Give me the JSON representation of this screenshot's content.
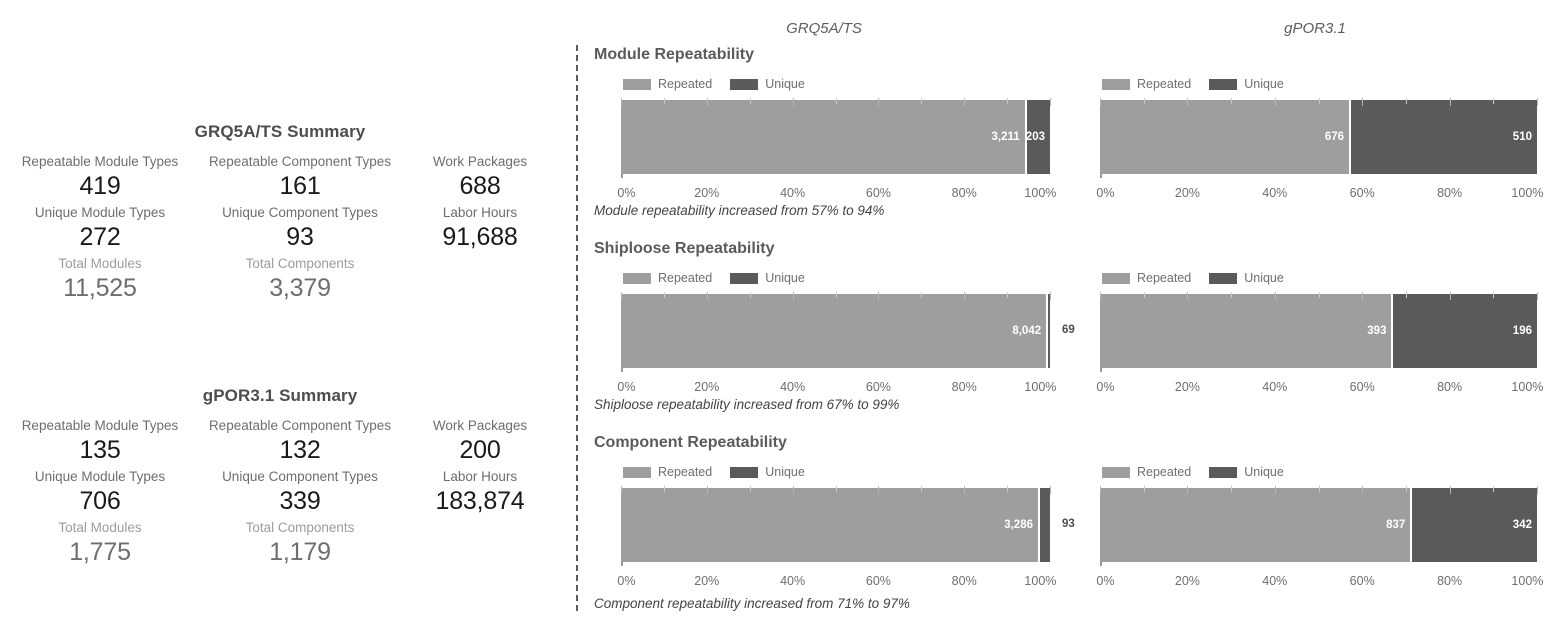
{
  "summaries": [
    {
      "title": "GRQ5A/TS Summary",
      "columns": [
        {
          "items": [
            {
              "label": "Repeatable Module Types",
              "value": "419",
              "muted": false
            },
            {
              "label": "Unique Module Types",
              "value": "272",
              "muted": false
            },
            {
              "label": "Total Modules",
              "value": "11,525",
              "muted": true
            }
          ]
        },
        {
          "items": [
            {
              "label": "Repeatable Component Types",
              "value": "161",
              "muted": false
            },
            {
              "label": "Unique Component Types",
              "value": "93",
              "muted": false
            },
            {
              "label": "Total Components",
              "value": "3,379",
              "muted": true
            }
          ]
        },
        {
          "items": [
            {
              "label": "Work Packages",
              "value": "688",
              "muted": false
            },
            {
              "label": "Labor Hours",
              "value": "91,688",
              "muted": false
            }
          ]
        }
      ]
    },
    {
      "title": "gPOR3.1 Summary",
      "columns": [
        {
          "items": [
            {
              "label": "Repeatable Module Types",
              "value": "135",
              "muted": false
            },
            {
              "label": "Unique Module Types",
              "value": "706",
              "muted": false
            },
            {
              "label": "Total Modules",
              "value": "1,775",
              "muted": true
            }
          ]
        },
        {
          "items": [
            {
              "label": "Repeatable Component Types",
              "value": "132",
              "muted": false
            },
            {
              "label": "Unique Component Types",
              "value": "339",
              "muted": false
            },
            {
              "label": "Total Components",
              "value": "1,179",
              "muted": true
            }
          ]
        },
        {
          "items": [
            {
              "label": "Work Packages",
              "value": "200",
              "muted": false
            },
            {
              "label": "Labor Hours",
              "value": "183,874",
              "muted": false
            }
          ]
        }
      ]
    }
  ],
  "column_headers": {
    "left": "GRQ5A/TS",
    "right": "gPOR3.1"
  },
  "legend": {
    "repeated": "Repeated",
    "unique": "Unique"
  },
  "colors": {
    "repeated": "#9e9e9e",
    "unique": "#5a5a5a",
    "axis_label": "#6e6e6e",
    "title": "#5b5b5b"
  },
  "axis": {
    "tick_labels": [
      "0%",
      "20%",
      "40%",
      "60%",
      "80%",
      "100%"
    ],
    "tick_values": [
      0,
      20,
      40,
      60,
      80,
      100
    ],
    "minor_step": 10
  },
  "rows": [
    {
      "title": "Module Repeatability",
      "note": "Module repeatability increased from 57% to 94%"
    },
    {
      "title": "Shiploose Repeatability",
      "note": "Shiploose repeatability increased from 67% to 99%"
    },
    {
      "title": "Component Repeatability",
      "note": "Component repeatability increased from 71% to 97%"
    }
  ],
  "chart_data": [
    {
      "type": "bar",
      "title": "Module Repeatability",
      "subtitle": "GRQ5A/TS",
      "orientation": "horizontal",
      "stacked": "percent",
      "categories": [
        "GRQ5A/TS"
      ],
      "series": [
        {
          "name": "Repeated",
          "values": [
            3211
          ],
          "label": "3,211",
          "percent": 94.1
        },
        {
          "name": "Unique",
          "values": [
            203
          ],
          "label": "203",
          "percent": 5.9
        }
      ],
      "xlabel": "",
      "ylabel": "",
      "xlim": [
        0,
        100
      ],
      "tick_labels": [
        "0%",
        "20%",
        "40%",
        "60%",
        "80%",
        "100%"
      ],
      "legend_position": "top-left",
      "grid": false
    },
    {
      "type": "bar",
      "title": "Module Repeatability",
      "subtitle": "gPOR3.1",
      "orientation": "horizontal",
      "stacked": "percent",
      "categories": [
        "gPOR3.1"
      ],
      "series": [
        {
          "name": "Repeated",
          "values": [
            676
          ],
          "label": "676",
          "percent": 57.0
        },
        {
          "name": "Unique",
          "values": [
            510
          ],
          "label": "510",
          "percent": 43.0
        }
      ],
      "xlabel": "",
      "ylabel": "",
      "xlim": [
        0,
        100
      ],
      "tick_labels": [
        "0%",
        "20%",
        "40%",
        "60%",
        "80%",
        "100%"
      ],
      "legend_position": "top-left",
      "grid": false
    },
    {
      "type": "bar",
      "title": "Shiploose Repeatability",
      "subtitle": "GRQ5A/TS",
      "orientation": "horizontal",
      "stacked": "percent",
      "categories": [
        "GRQ5A/TS"
      ],
      "series": [
        {
          "name": "Repeated",
          "values": [
            8042
          ],
          "label": "8,042",
          "percent": 99.1
        },
        {
          "name": "Unique",
          "values": [
            69
          ],
          "label": "69",
          "percent": 0.9
        }
      ],
      "xlabel": "",
      "ylabel": "",
      "xlim": [
        0,
        100
      ],
      "tick_labels": [
        "0%",
        "20%",
        "40%",
        "60%",
        "80%",
        "100%"
      ],
      "legend_position": "top-left",
      "grid": false
    },
    {
      "type": "bar",
      "title": "Shiploose Repeatability",
      "subtitle": "gPOR3.1",
      "orientation": "horizontal",
      "stacked": "percent",
      "categories": [
        "gPOR3.1"
      ],
      "series": [
        {
          "name": "Repeated",
          "values": [
            393
          ],
          "label": "393",
          "percent": 66.7
        },
        {
          "name": "Unique",
          "values": [
            196
          ],
          "label": "196",
          "percent": 33.3
        }
      ],
      "xlabel": "",
      "ylabel": "",
      "xlim": [
        0,
        100
      ],
      "tick_labels": [
        "0%",
        "20%",
        "40%",
        "60%",
        "80%",
        "100%"
      ],
      "legend_position": "top-left",
      "grid": false
    },
    {
      "type": "bar",
      "title": "Component Repeatability",
      "subtitle": "GRQ5A/TS",
      "orientation": "horizontal",
      "stacked": "percent",
      "categories": [
        "GRQ5A/TS"
      ],
      "series": [
        {
          "name": "Repeated",
          "values": [
            3286
          ],
          "label": "3,286",
          "percent": 97.2
        },
        {
          "name": "Unique",
          "values": [
            93
          ],
          "label": "93",
          "percent": 2.8
        }
      ],
      "xlabel": "",
      "ylabel": "",
      "xlim": [
        0,
        100
      ],
      "tick_labels": [
        "0%",
        "20%",
        "40%",
        "60%",
        "80%",
        "100%"
      ],
      "legend_position": "top-left",
      "grid": false
    },
    {
      "type": "bar",
      "title": "Component Repeatability",
      "subtitle": "gPOR3.1",
      "orientation": "horizontal",
      "stacked": "percent",
      "categories": [
        "gPOR3.1"
      ],
      "series": [
        {
          "name": "Repeated",
          "values": [
            837
          ],
          "label": "837",
          "percent": 71.0
        },
        {
          "name": "Unique",
          "values": [
            342
          ],
          "label": "342",
          "percent": 29.0
        }
      ],
      "xlabel": "",
      "ylabel": "",
      "xlim": [
        0,
        100
      ],
      "tick_labels": [
        "0%",
        "20%",
        "40%",
        "60%",
        "80%",
        "100%"
      ],
      "legend_position": "top-left",
      "grid": false
    }
  ]
}
